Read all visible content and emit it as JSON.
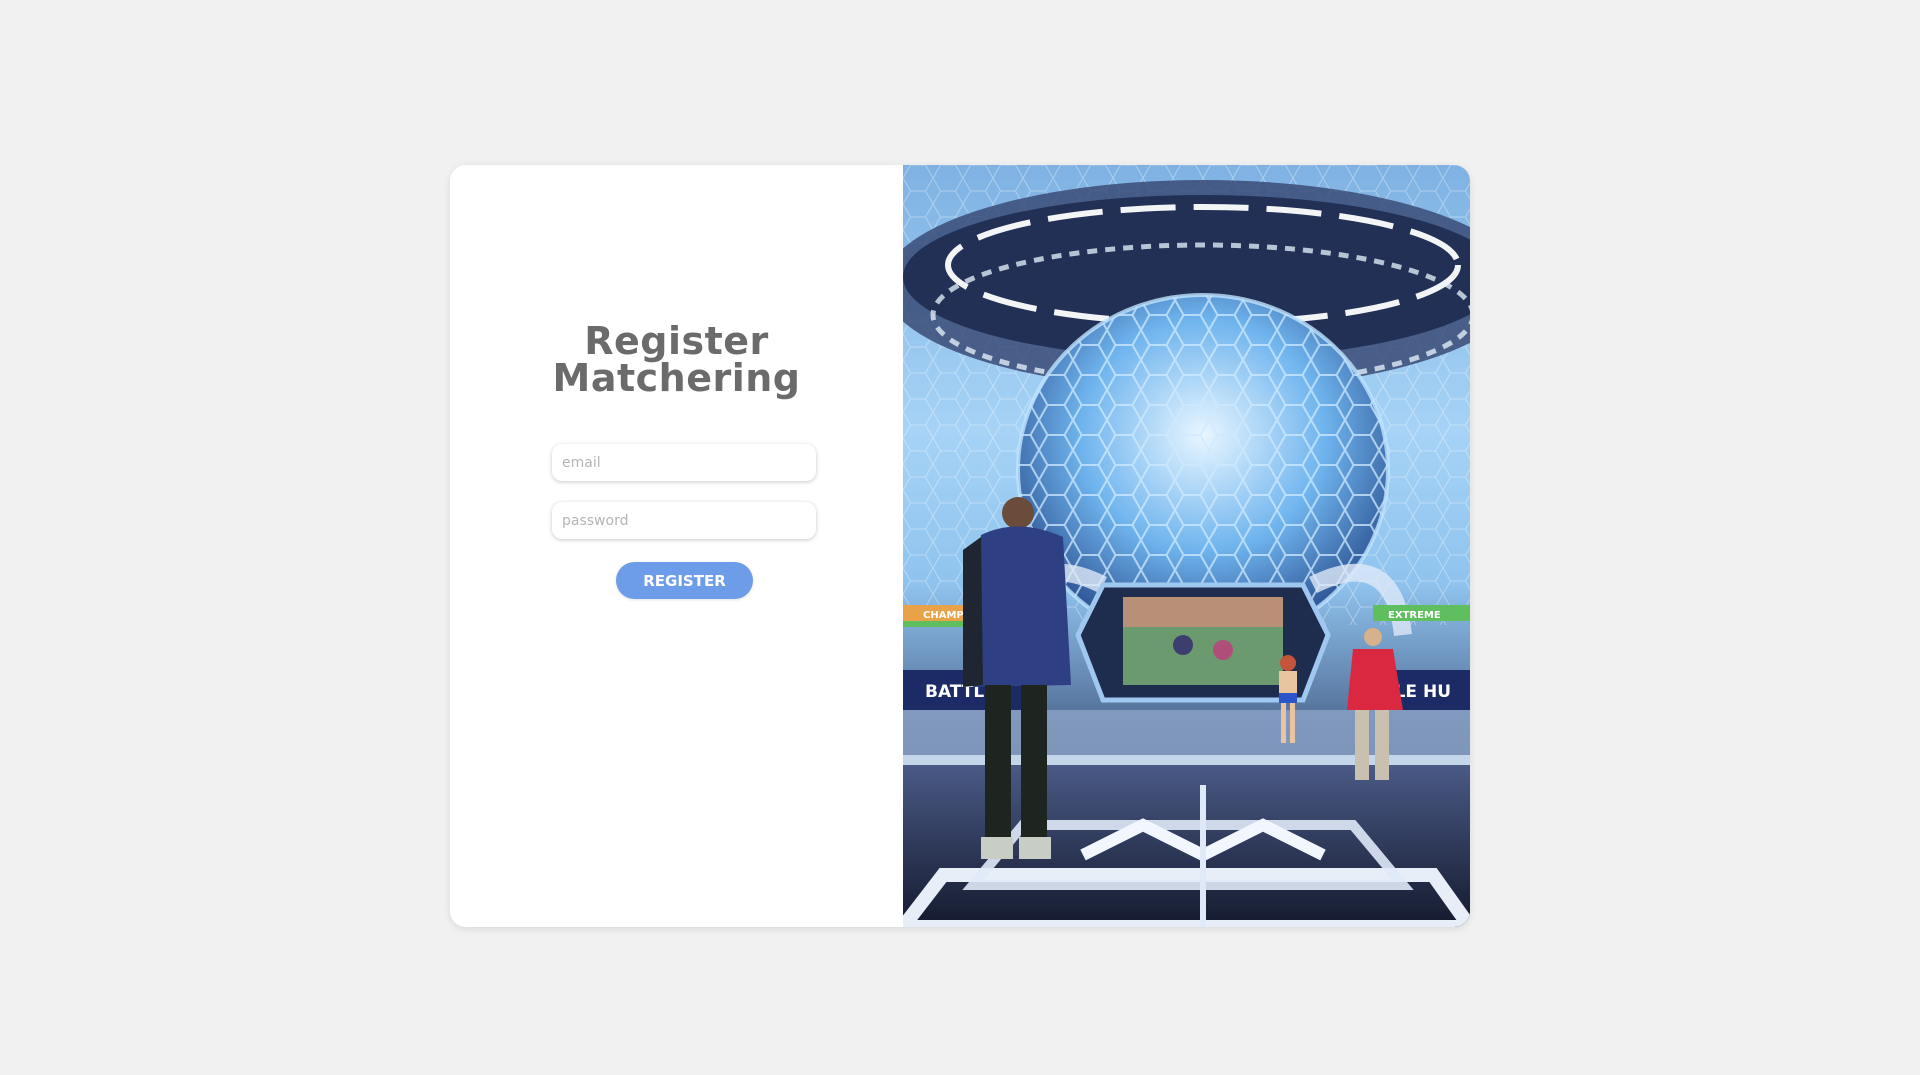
{
  "page": {
    "background_color": "#f1f1f1"
  },
  "form": {
    "title_line1": "Register",
    "title_line2": "Matchering",
    "email_placeholder": "email",
    "password_placeholder": "password",
    "register_label": "REGISTER",
    "button_color": "#6d9ce8",
    "title_color": "#6b6b6b"
  },
  "hero": {
    "banner_left": "CHAMP",
    "banner_right": "EXTREME",
    "sign_left": "BATTLE",
    "sign_right": "TLE HU"
  }
}
